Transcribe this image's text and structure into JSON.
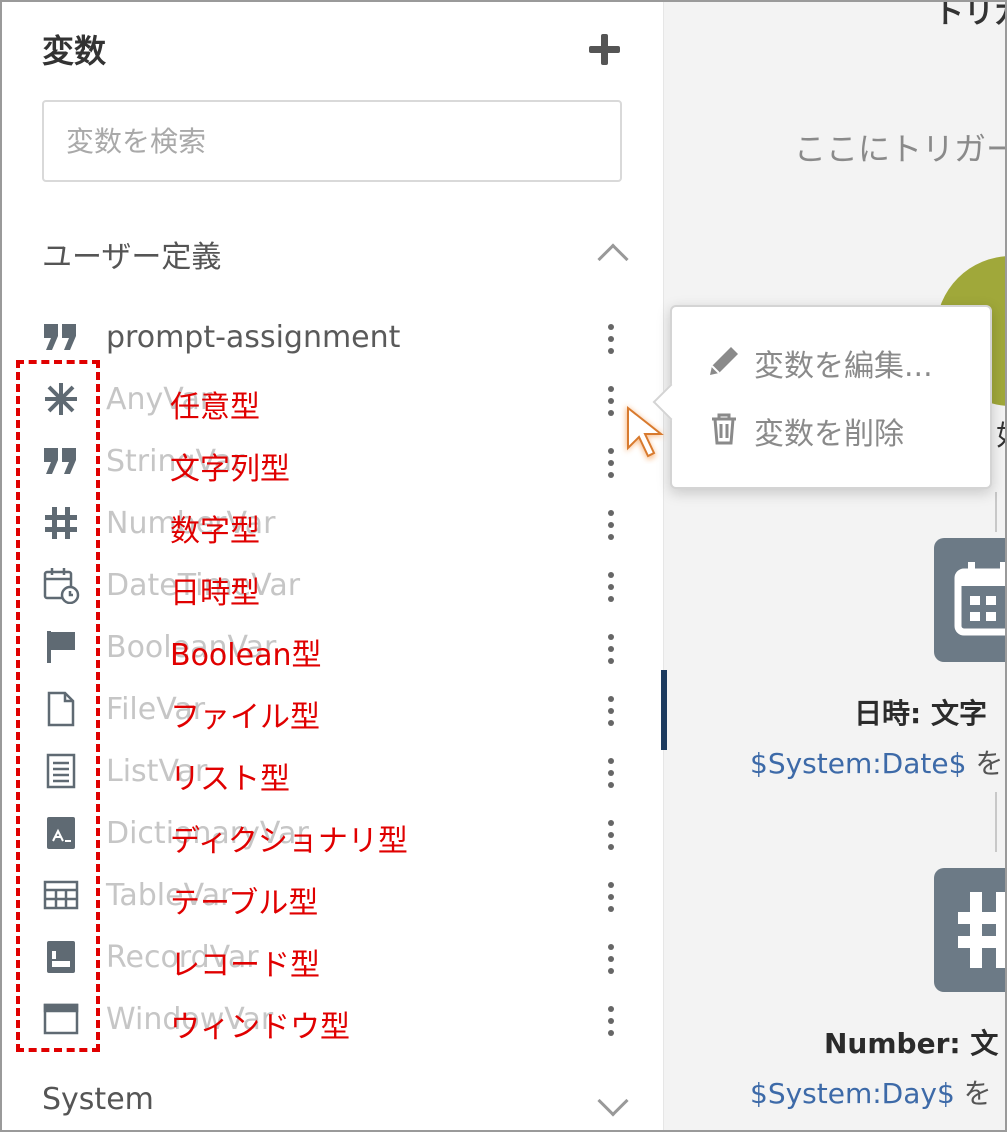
{
  "panel": {
    "title": "変数",
    "search_placeholder": "変数を検索",
    "sections": {
      "user_defined": "ユーザー定義",
      "system": "System"
    }
  },
  "variables": [
    {
      "name": "prompt-assignment",
      "icon": "quote-icon",
      "annotation": ""
    },
    {
      "name": "AnyVar",
      "icon": "asterisk-icon",
      "annotation": "任意型"
    },
    {
      "name": "StringVar",
      "icon": "quote-icon",
      "annotation": "文字列型"
    },
    {
      "name": "NumberVar",
      "icon": "hash-icon",
      "annotation": "数字型"
    },
    {
      "name": "DateTimeVar",
      "icon": "calendar-clock-icon",
      "annotation": "日時型"
    },
    {
      "name": "BooleanVar",
      "icon": "flag-icon",
      "annotation": "Boolean型"
    },
    {
      "name": "FileVar",
      "icon": "file-icon",
      "annotation": "ファイル型"
    },
    {
      "name": "ListVar",
      "icon": "list-icon",
      "annotation": "リスト型"
    },
    {
      "name": "DictionaryVar",
      "icon": "dictionary-icon",
      "annotation": "ディクショナリ型"
    },
    {
      "name": "TableVar",
      "icon": "table-icon",
      "annotation": "テーブル型"
    },
    {
      "name": "RecordVar",
      "icon": "record-icon",
      "annotation": "レコード型"
    },
    {
      "name": "WindowVar",
      "icon": "window-icon",
      "annotation": "ウィンドウ型"
    }
  ],
  "context_menu": {
    "edit": "変数を編集...",
    "delete": "変数を削除"
  },
  "canvas": {
    "title_partial": "トリガ",
    "hint_partial": "ここにトリガー",
    "partial_char": "如",
    "step1": {
      "label": "日時: 文字",
      "sub": "$System:Date$",
      "sub_tail": "を"
    },
    "step2": {
      "label": "Number: 文",
      "sub": "$System:Day$",
      "sub_tail": "を"
    }
  },
  "colors": {
    "annotation": "#e00000",
    "step_sub": "#3d6aa8",
    "green_trigger": "#a0a83a",
    "card": "#6c7a86"
  }
}
